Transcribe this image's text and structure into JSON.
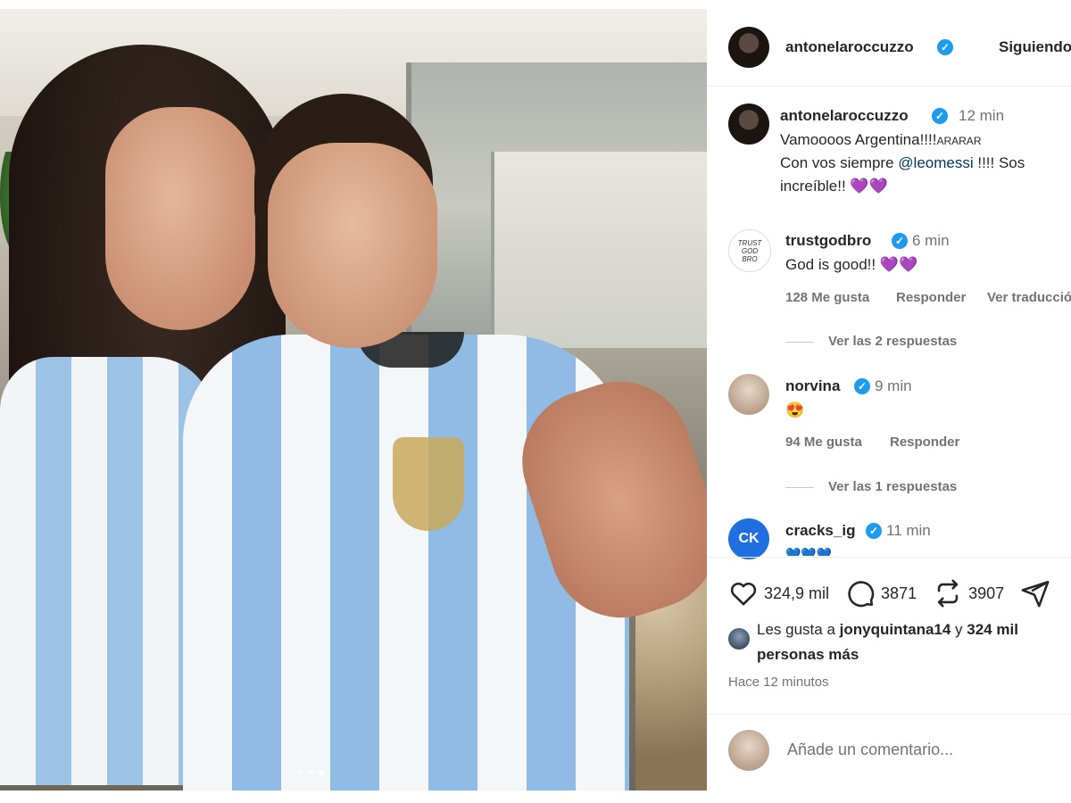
{
  "post": {
    "author": "antonelaroccuzzo",
    "follow_label": "Siguiendo",
    "caption_time": "12 min",
    "caption_line1": "Vamoooos Argentina!!!!",
    "caption_line1_suffix": "ARARAR",
    "caption_line2_prefix": "Con vos siempre ",
    "caption_mention": "@leomessi",
    "caption_line2_suffix": " !!!! Sos",
    "caption_line3": "increíble!! 💜💜",
    "carousel_pages": 3,
    "carousel_active": 3
  },
  "comments": [
    {
      "user": "trustgodbro",
      "time": "6 min",
      "text": "God is good!! 💜💜",
      "likes": "128 Me gusta",
      "reply": "Responder",
      "translate": "Ver traducción",
      "replies": "Ver las 2 respuestas"
    },
    {
      "user": "norvina",
      "time": "9 min",
      "text": "😍",
      "likes": "94 Me gusta",
      "reply": "Responder",
      "replies": "Ver las 1 respuestas"
    },
    {
      "user": "cracks_ig",
      "time": "11 min",
      "text": "💙💙💙",
      "avatar_text": "CK"
    }
  ],
  "stats": {
    "likes": "324,9 mil",
    "comments": "3871",
    "reposts": "3907"
  },
  "liked_by": {
    "prefix": "Les gusta a ",
    "user": "jonyquintana14",
    "middle": " y ",
    "others": "324 mil",
    "line2": "personas más"
  },
  "posted_ago": "Hace 12 minutos",
  "comment_placeholder": "Añade un comentario...",
  "colors": {
    "verified": "#1d9bf0",
    "mention": "#00376b",
    "muted": "#737373"
  }
}
